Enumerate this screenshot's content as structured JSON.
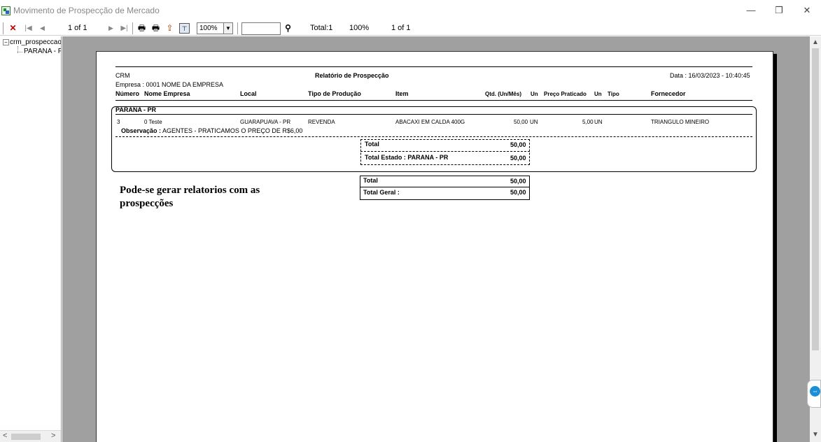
{
  "window": {
    "title": "Movimento de Prospecção de Mercado",
    "minimize": "—",
    "maximize": "❐",
    "close": "✕"
  },
  "toolbar": {
    "page_indicator": "1 of 1",
    "zoom": "100%",
    "search_value": "",
    "status_total": "Total:1",
    "status_zoom": "100%",
    "status_page": "1 of 1",
    "icons": [
      "close-icon",
      "first-page-icon",
      "previous-page-icon",
      "next-page-icon",
      "last-page-icon",
      "print-icon",
      "print-setup-icon",
      "export-icon",
      "group-tree-icon",
      "find-icon"
    ]
  },
  "tree": {
    "root": "crm_prospeccao",
    "child": "PARANA - PR"
  },
  "report": {
    "header_left": "CRM",
    "title": "Relatório de Prospecção",
    "date": "Data : 16/03/2023 - 10:40:45",
    "company": "Empresa : 0001 NOME DA EMPRESA",
    "columns": {
      "numero": "Número",
      "nome_empresa": "Nome Empresa",
      "local": "Local",
      "tipo_producao": "Tipo de Produção",
      "item": "Item",
      "qtd": "Qtd. (Un/Mês)",
      "un1": "Un",
      "preco": "Preço Praticado",
      "un2": "Un",
      "tipo": "Tipo",
      "fornecedor": "Fornecedor"
    },
    "group_label": "PARANA - PR",
    "row": {
      "numero": "3",
      "nome_empresa": "0 Teste",
      "local": "GUARAPUAVA - PR",
      "tipo_producao": "REVENDA",
      "item": "ABACAXI EM CALDA 400G",
      "qtd": "50,00",
      "un1": "UN",
      "preco": "5,00",
      "un2": "UN",
      "tipo": "",
      "fornecedor": "TRIANGULO MINEIRO"
    },
    "observation_label": "Observação :",
    "observation_text": " AGENTES - PRATICAMOS O PREÇO DE R$6,00",
    "group_total_label": "Total",
    "group_total_value": "50,00",
    "state_total_label": "Total Estado : PARANA - PR",
    "state_total_value": "50,00",
    "total_label": "Total",
    "total_value": "50,00",
    "grand_total_label": "Total Geral :",
    "grand_total_value": "50,00",
    "note": "Pode-se gerar relatorios com as prospecções"
  }
}
